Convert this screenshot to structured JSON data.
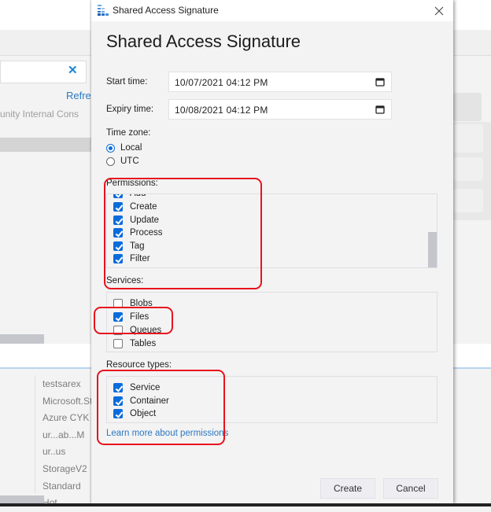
{
  "background": {
    "refresh_link": "Refres",
    "subscription_text": "unity Internal Cons",
    "list_values": [
      "testsarex",
      "Microsoft.St",
      "Azure CYK C",
      "ur...ab...M",
      "ur..us",
      "StorageV2",
      "Standard",
      "Hot"
    ]
  },
  "dialog": {
    "window_title": "Shared Access Signature",
    "heading": "Shared Access Signature",
    "close_icon": "close-icon",
    "start_time": {
      "label": "Start time:",
      "value": "10/07/2021  04:12  PM"
    },
    "expiry_time": {
      "label": "Expiry time:",
      "value": "10/08/2021  04:12  PM"
    },
    "time_zone": {
      "label": "Time zone:",
      "options": [
        {
          "label": "Local",
          "selected": true
        },
        {
          "label": "UTC",
          "selected": false
        }
      ]
    },
    "permissions": {
      "label": "Permissions:",
      "items": [
        {
          "label": "Add",
          "checked": true
        },
        {
          "label": "Create",
          "checked": true
        },
        {
          "label": "Update",
          "checked": true
        },
        {
          "label": "Process",
          "checked": true
        },
        {
          "label": "Tag",
          "checked": true
        },
        {
          "label": "Filter",
          "checked": true
        }
      ]
    },
    "services": {
      "label": "Services:",
      "items": [
        {
          "label": "Blobs",
          "checked": false
        },
        {
          "label": "Files",
          "checked": true
        },
        {
          "label": "Queues",
          "checked": false
        },
        {
          "label": "Tables",
          "checked": false
        }
      ]
    },
    "resource_types": {
      "label": "Resource types:",
      "items": [
        {
          "label": "Service",
          "checked": true
        },
        {
          "label": "Container",
          "checked": true
        },
        {
          "label": "Object",
          "checked": true
        }
      ]
    },
    "learn_more_link": "Learn more about permissions",
    "create_button": "Create",
    "cancel_button": "Cancel"
  },
  "annotation_color": "#e8121c",
  "accent_color": "#0a6cdc"
}
